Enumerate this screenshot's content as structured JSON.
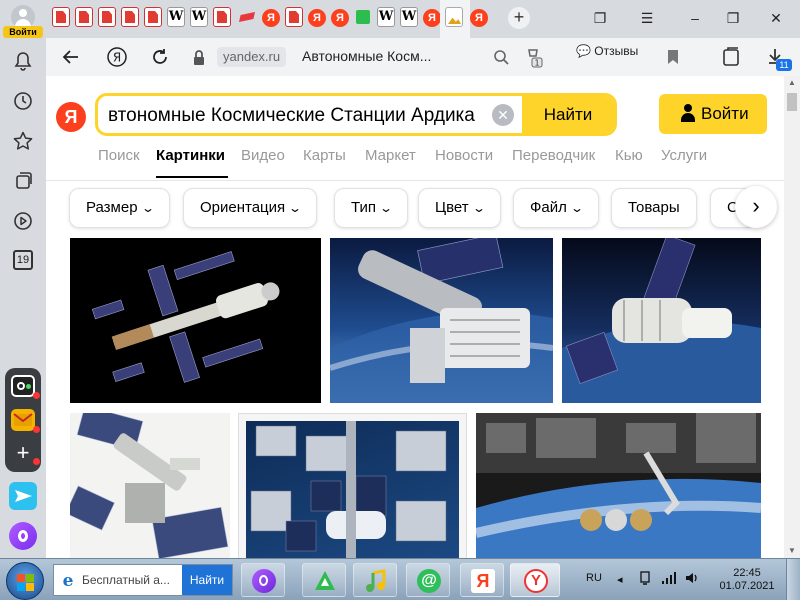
{
  "profile": {
    "login_label": "Войти"
  },
  "nav": {
    "domain": "yandex.ru",
    "page_title": "Автономные Косм...",
    "reviews_label": "Отзывы",
    "downloads_badge": "11"
  },
  "search": {
    "query": "втономные Космические Станции Ардика",
    "submit_label": "Найти"
  },
  "header": {
    "login_label": "Войти"
  },
  "services": [
    {
      "label": "Поиск",
      "active": false
    },
    {
      "label": "Картинки",
      "active": true
    },
    {
      "label": "Видео",
      "active": false
    },
    {
      "label": "Карты",
      "active": false
    },
    {
      "label": "Маркет",
      "active": false
    },
    {
      "label": "Новости",
      "active": false
    },
    {
      "label": "Переводчик",
      "active": false
    },
    {
      "label": "Кью",
      "active": false
    },
    {
      "label": "Услуги",
      "active": false
    }
  ],
  "filters": [
    {
      "label": "Размер",
      "dropdown": true
    },
    {
      "label": "Ориентация",
      "dropdown": true
    },
    {
      "label": "Тип",
      "dropdown": true
    },
    {
      "label": "Цвет",
      "dropdown": true
    },
    {
      "label": "Файл",
      "dropdown": true
    },
    {
      "label": "Товары",
      "dropdown": false
    },
    {
      "label": "С",
      "dropdown": false
    }
  ],
  "sidebar": {
    "calendar_day": "19"
  },
  "taskbar": {
    "search_text": "Бесплатный а...",
    "search_button": "Найти",
    "language": "RU",
    "time": "22:45",
    "date": "01.07.2021"
  },
  "colors": {
    "yandex_yellow": "#fed42b",
    "yandex_red": "#fc3f1d",
    "tabbar": "#d7dbe0"
  }
}
